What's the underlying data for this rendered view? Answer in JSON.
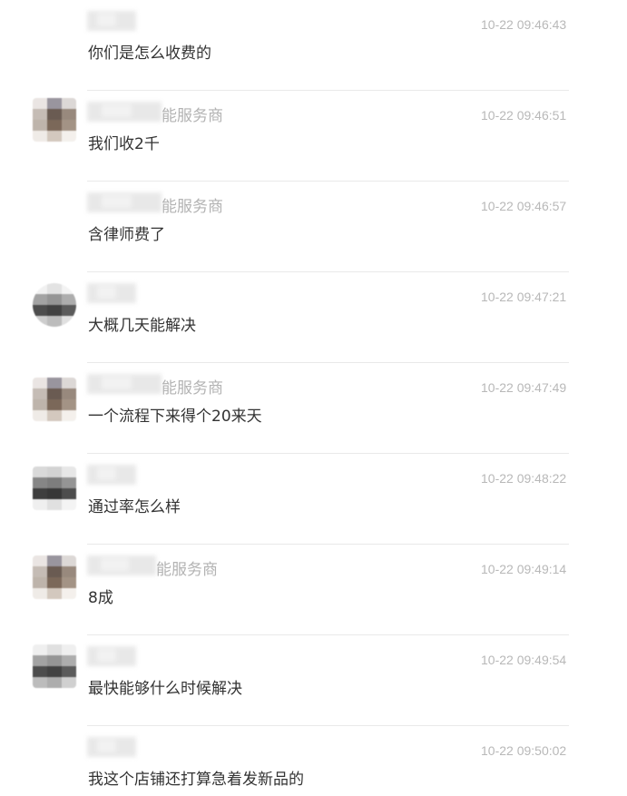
{
  "messages": [
    {
      "sender_suffix": "",
      "time": "10-22 09:46:43",
      "text": "你们是怎么收费的",
      "has_avatar": false,
      "role": "customer"
    },
    {
      "sender_suffix": "能服务商",
      "time": "10-22 09:46:51",
      "text": "我们收2千",
      "has_avatar": true,
      "role": "provider"
    },
    {
      "sender_suffix": "能服务商",
      "time": "10-22 09:46:57",
      "text": "含律师费了",
      "has_avatar": false,
      "role": "provider"
    },
    {
      "sender_suffix": "",
      "time": "10-22 09:47:21",
      "text": "大概几天能解决",
      "has_avatar": true,
      "role": "customer"
    },
    {
      "sender_suffix": "能服务商",
      "time": "10-22 09:47:49",
      "text": "一个流程下来得个20来天",
      "has_avatar": true,
      "role": "provider"
    },
    {
      "sender_suffix": "",
      "time": "10-22 09:48:22",
      "text": "通过率怎么样",
      "has_avatar": true,
      "role": "customer"
    },
    {
      "sender_suffix": "能服务商",
      "time": "10-22 09:49:14",
      "text": "8成",
      "has_avatar": true,
      "role": "provider"
    },
    {
      "sender_suffix": "",
      "time": "10-22 09:49:54",
      "text": "最快能够什么时候解决",
      "has_avatar": true,
      "role": "customer"
    },
    {
      "sender_suffix": "",
      "time": "10-22 09:50:02",
      "text": "我这个店铺还打算急着发新品的",
      "has_avatar": false,
      "role": "customer"
    }
  ],
  "colors": {
    "text": "#333333",
    "timestamp": "#b8b8b8",
    "sender_suffix": "#b3b3b3",
    "divider": "#e9e9e9",
    "background": "#ffffff"
  }
}
